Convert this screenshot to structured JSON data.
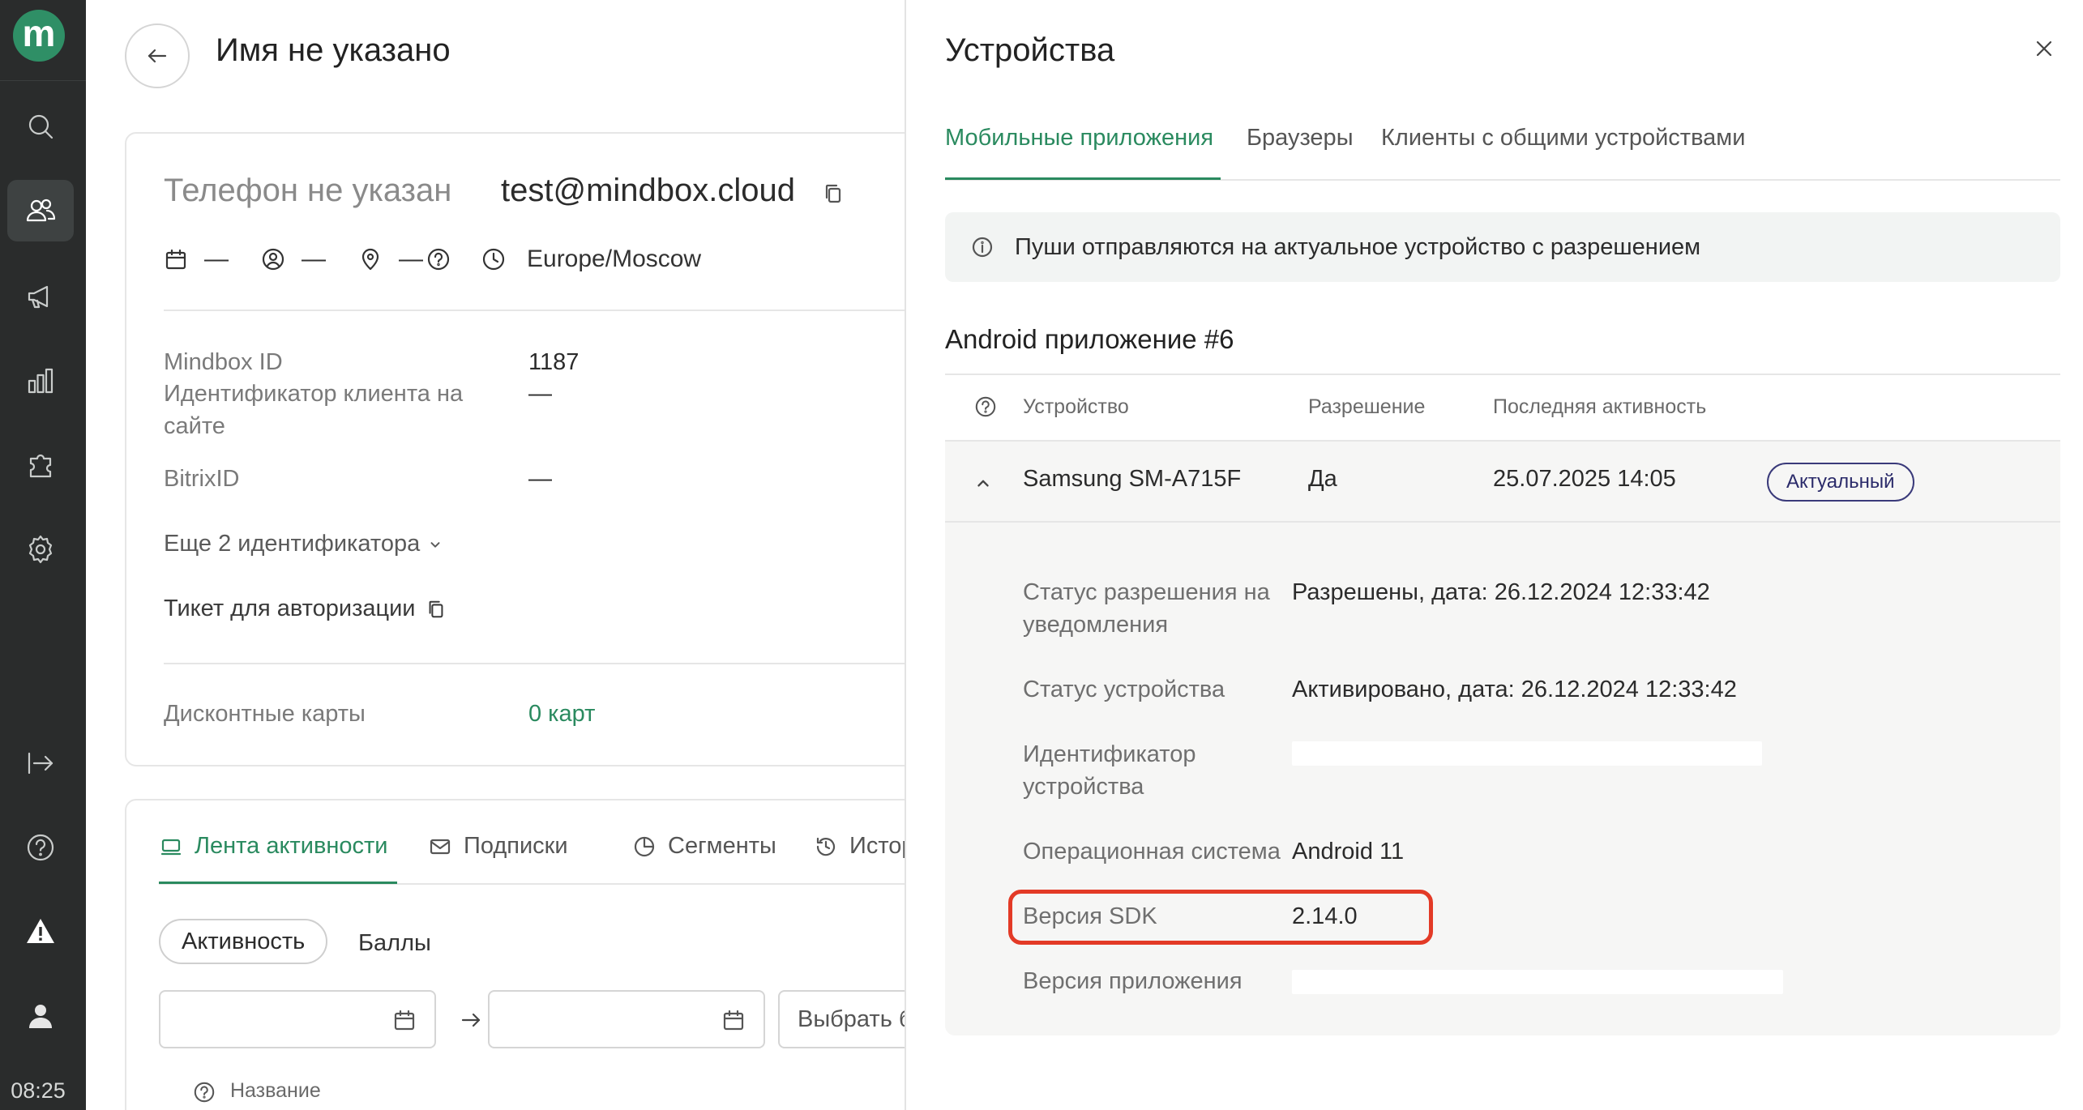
{
  "sidebar": {
    "logo_letter": "m",
    "items": [
      {
        "name": "search-icon"
      },
      {
        "name": "customers-icon",
        "active": true
      },
      {
        "name": "megaphone-icon"
      },
      {
        "name": "analytics-icon"
      },
      {
        "name": "integrations-icon"
      },
      {
        "name": "settings-icon"
      },
      {
        "name": "exit-icon"
      },
      {
        "name": "help-icon"
      },
      {
        "name": "warning-icon"
      },
      {
        "name": "user-icon"
      }
    ],
    "time": "08:25"
  },
  "customer": {
    "title": "Имя не указано",
    "phone": "Телефон не указан",
    "email": "test@mindbox.cloud",
    "birthday": "—",
    "gender": "—",
    "location": "—",
    "timezone": "Europe/Moscow",
    "fields": [
      {
        "label": "Mindbox ID",
        "value": "1187"
      },
      {
        "label": "Идентификатор клиента на сайте",
        "value": "—"
      },
      {
        "label": "BitrixID",
        "value": "—"
      }
    ],
    "more_ids": "Еще 2 идентификатора",
    "ticket": "Тикет для авторизации",
    "discount_label": "Дисконтные карты",
    "discount_value": "0 карт"
  },
  "activity": {
    "tabs": [
      "Лента активности",
      "Подписки",
      "Сегменты",
      "История"
    ],
    "chips": [
      "Активность",
      "Баллы"
    ],
    "choose": "Выбрать б",
    "column_name": "Название"
  },
  "drawer": {
    "title": "Устройства",
    "tabs": [
      "Мобильные приложения",
      "Браузеры",
      "Клиенты с общими устройствами"
    ],
    "notice": "Пуши отправляются на актуальное устройство с разрешением",
    "app_title": "Android приложение #6",
    "headers": [
      "Устройство",
      "Разрешение",
      "Последняя активность"
    ],
    "row": {
      "device": "Samsung SM-A715F",
      "permission": "Да",
      "last_activity": "25.07.2025 14:05",
      "badge": "Актуальный"
    },
    "details": [
      {
        "label": "Статус разрешения на уведомления",
        "value": "Разрешены, дата: 26.12.2024 12:33:42"
      },
      {
        "label": "Статус устройства",
        "value": "Активировано, дата: 26.12.2024 12:33:42"
      },
      {
        "label": "Идентификатор устройства",
        "value": ""
      },
      {
        "label": "Операционная система",
        "value": "Android 11"
      },
      {
        "label": "Версия SDK",
        "value": "2.14.0"
      },
      {
        "label": "Версия приложения",
        "value": ""
      }
    ]
  },
  "colors": {
    "accent": "#2a8a5f",
    "sidebar": "#2a2c2c",
    "highlight": "#e33a26"
  }
}
